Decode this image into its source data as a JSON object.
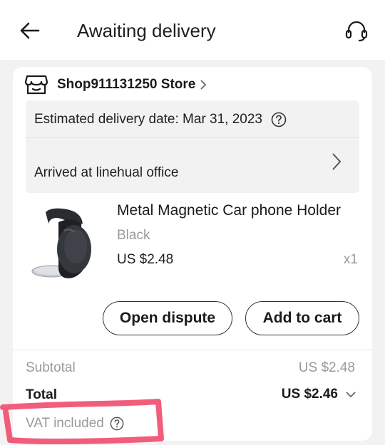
{
  "header": {
    "title": "Awaiting delivery",
    "back_icon": "back-arrow-icon",
    "support_icon": "headset-icon"
  },
  "order": {
    "store": {
      "icon": "store-icon",
      "name": "Shop911131250 Store"
    },
    "delivery": {
      "estimated": "Estimated delivery date: Mar 31, 2023",
      "status": "Arrived at linehual office"
    },
    "product": {
      "title": "Metal Magnetic Car phone Holder",
      "variant": "Black",
      "price": "US $2.48",
      "quantity": "x1"
    },
    "actions": {
      "open_dispute": "Open dispute",
      "add_to_cart": "Add to cart"
    },
    "summary": {
      "subtotal_label": "Subtotal",
      "subtotal_value": "US $2.48",
      "total_label": "Total",
      "total_value": "US $2.46",
      "vat_label": "VAT included"
    }
  },
  "colors": {
    "background": "#f2f2f2",
    "card": "#ffffff",
    "muted_text": "#9a9a9a",
    "annotation": "#f0476a"
  }
}
